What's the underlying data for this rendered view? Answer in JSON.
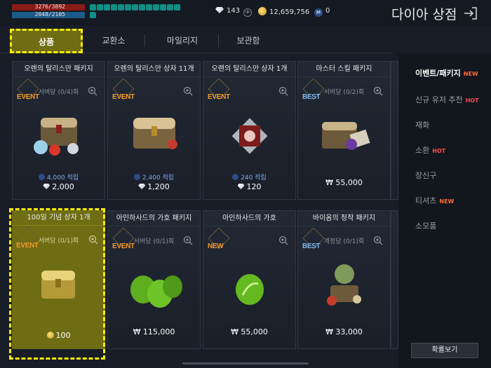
{
  "status": {
    "hp": "3276/3892",
    "mp": "2048/2105"
  },
  "currency": {
    "diamonds": "143",
    "gold": "12,659,756",
    "mileage": "0"
  },
  "header": {
    "title": "다이아 상점"
  },
  "tabs": [
    {
      "label": "상품",
      "active": true
    },
    {
      "label": "교환소"
    },
    {
      "label": "마일리지"
    },
    {
      "label": "보관함"
    }
  ],
  "products": [
    {
      "title": "오렌의 탈리스만 패키지",
      "badge": "EVENT",
      "limit": "서버당 (0/4)회",
      "mileage": "4,000 적립",
      "price": "2,000",
      "price_type": "diamond"
    },
    {
      "title": "오렌의 탈리스만 상자 11개",
      "badge": "EVENT",
      "limit": "",
      "mileage": "2,400 적립",
      "price": "1,200",
      "price_type": "diamond"
    },
    {
      "title": "오렌의 탈리스만 상자 1개",
      "badge": "EVENT",
      "limit": "",
      "mileage": "240 적립",
      "price": "120",
      "price_type": "diamond"
    },
    {
      "title": "마스터 스킬 패키지",
      "badge": "BEST",
      "limit": "서버당 (0/2)회",
      "mileage": "",
      "price": "₩ 55,000",
      "price_type": "krw"
    },
    {
      "title": "100일 기념 상자 1개",
      "badge": "EVENT",
      "limit": "서버당 (0/1)회",
      "mileage": "",
      "price": "100",
      "price_type": "gold"
    },
    {
      "title": "아인하사드의 가호 패키지",
      "badge": "EVENT",
      "limit": "서버당 (0/1)회",
      "mileage": "",
      "price": "₩ 115,000",
      "price_type": "krw"
    },
    {
      "title": "아인하사드의 가호",
      "badge": "NEW",
      "limit": "",
      "mileage": "",
      "price": "₩ 55,000",
      "price_type": "krw"
    },
    {
      "title": "바이옴의 정착 패키지",
      "badge": "BEST",
      "limit": "계정당 (0/1)회",
      "mileage": "",
      "price": "₩ 33,000",
      "price_type": "krw"
    }
  ],
  "categories": [
    {
      "label": "이벤트/패키지",
      "tag": "NEW",
      "active": true
    },
    {
      "label": "신규 유저 추천",
      "tag": "HOT"
    },
    {
      "label": "재화",
      "tag": ""
    },
    {
      "label": "소환",
      "tag": "HOT"
    },
    {
      "label": "장신구",
      "tag": ""
    },
    {
      "label": "티셔츠",
      "tag": "NEW"
    },
    {
      "label": "소모품",
      "tag": ""
    }
  ],
  "buttons": {
    "probability": "확률보기"
  },
  "colors": {
    "highlight": "#6f6d13",
    "dash": "#ffee00",
    "event_badge": "#f29a2e",
    "best_badge": "#7fb9f0"
  }
}
